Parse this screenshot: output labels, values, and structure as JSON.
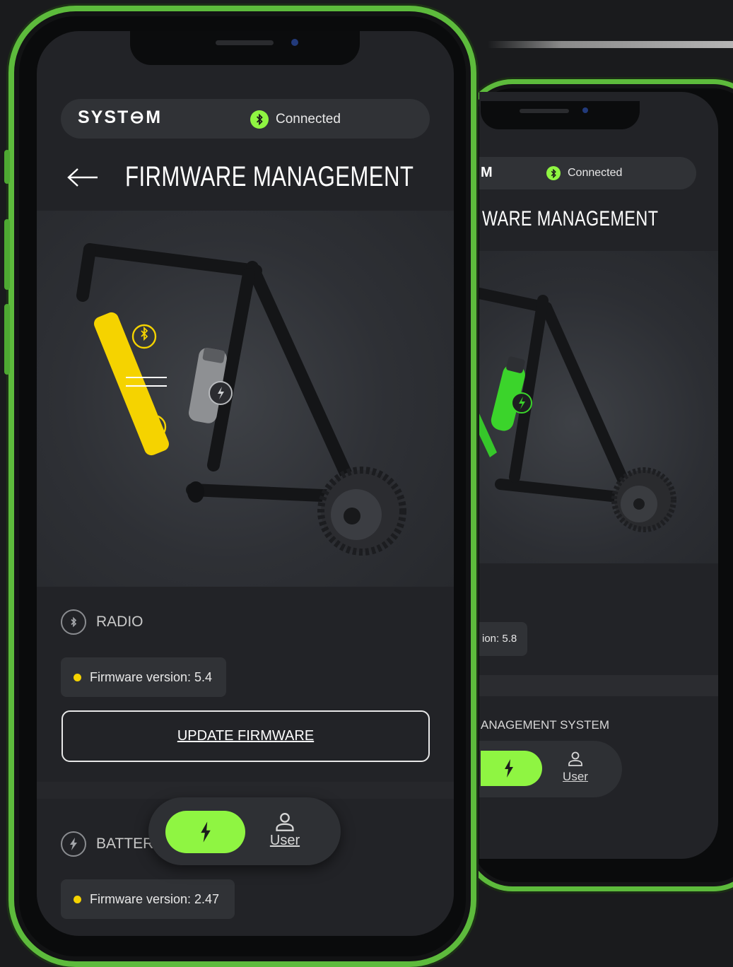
{
  "brand": {
    "accent": "#8ff542",
    "frame": "#5dbb3c",
    "highlight_yellow": "#f5d300"
  },
  "front": {
    "header": {
      "logo": "SYST⊖M",
      "status_label": "Connected",
      "status_icon": "bluetooth-icon"
    },
    "title": "FIRMWARE MANAGEMENT",
    "back_icon": "arrow-left-icon",
    "radio": {
      "label": "RADIO",
      "icon": "bluetooth-icon",
      "firmware": "Firmware version: 5.4",
      "update_label": "UPDATE FIRMWARE"
    },
    "battery": {
      "label": "BATTER",
      "icon": "bolt-icon",
      "firmware": "Firmware version: 2.47"
    },
    "tabbar": {
      "active_icon": "bolt-icon",
      "user_label": "User",
      "user_icon": "user-icon"
    }
  },
  "back": {
    "header": {
      "logo": "M",
      "status_label": "Connected"
    },
    "title": "WARE MANAGEMENT",
    "chip": "ion: 5.8",
    "section": "ANAGEMENT SYSTEM",
    "tabbar": {
      "user_label": "User"
    }
  }
}
